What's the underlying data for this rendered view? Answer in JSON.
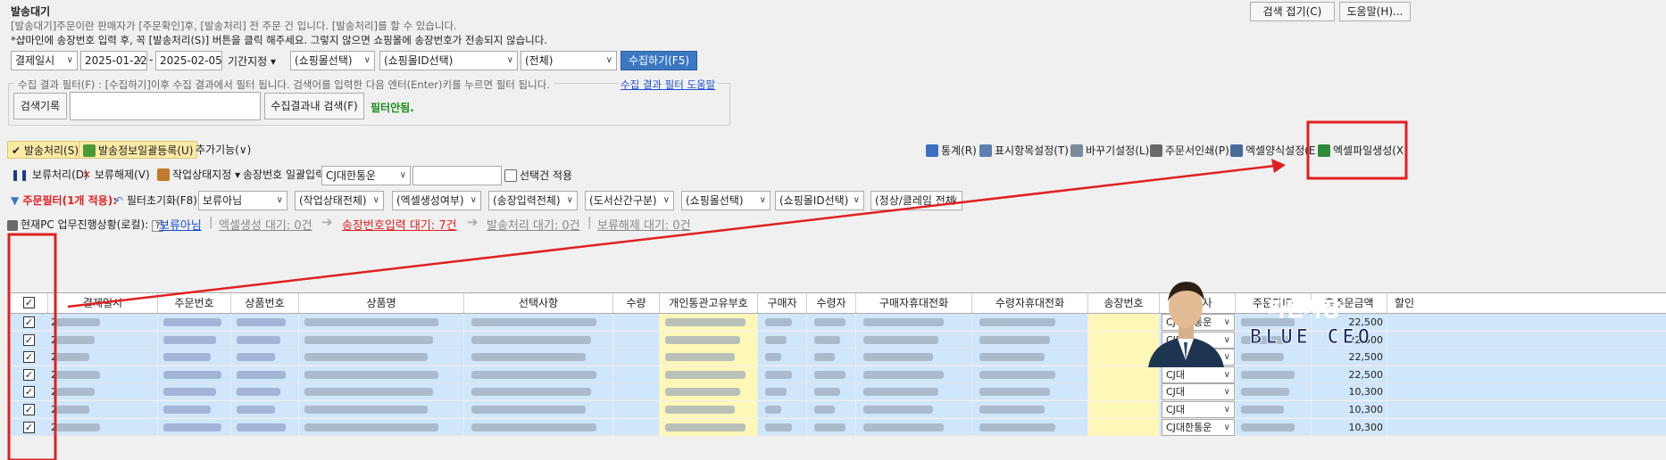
{
  "window": {
    "title": "발송대기"
  },
  "top_buttons": {
    "collapse_search": "검색 접기(C)",
    "help": "도움말(H)..."
  },
  "description": {
    "line1": "[발송대기]주문이란 판매자가 [주문확인]후, [발송처리] 전 주문 건 입니다. [발송처리]를 할 수 있습니다.",
    "line2": "*샵마인에 송장번호 입력 후, 꼭 [발송처리(S)] 버튼을 클릭 해주세요. 그렇지 않으면 쇼핑몰에 송장번호가 전송되지 않습니다."
  },
  "search": {
    "date_type": "결제일시",
    "date_from": "2025-01-22",
    "date_sep": "-",
    "date_to": "2025-02-05(",
    "period_label": "기간지정",
    "mall_select": "(쇼핑몰선택)",
    "mall_id_select": "(쇼핑몰ID선택)",
    "all_select": "(전체)",
    "collect_button": "수집하기(F5)"
  },
  "filter_box": {
    "legend": "수집 결과 필터(F) : [수집하기]이후 수집 결과에서 필터 됩니다. 검색어를 입력한 다음 엔터(Enter)키를 누르면 필터 됩니다.",
    "help_link": "수집 결과 필터 도움말",
    "history_button": "검색기록",
    "search_in_results_button": "수집결과내 검색(F)",
    "filter_status": "필터안됨."
  },
  "toolbar1": {
    "ship_process": "발송처리(S)",
    "bulk_register": "발송정보일괄등록(U)",
    "more_features": "추가기능(∨)",
    "stats": "통계(R)",
    "display_items": "표시항목설정(T)",
    "barcode_settings": "바꾸기설정(L)",
    "print_order": "주문서인쇄(P)",
    "excel_format": "엑셀양식설정(E",
    "excel_generate": "엑셀파일생성(X)"
  },
  "toolbar2": {
    "hold": "보류처리(D)",
    "unhold": "보류해제(V)",
    "work_status": "작업상태지정",
    "bulk_invoice_label": "송장번호 일괄입력",
    "courier_select": "CJ대한통운",
    "invoice_input": "",
    "apply_selected": "선택건 적용"
  },
  "toolbar3": {
    "order_filter": "주문필터(1개 적용):",
    "reset_filter": "필터초기화(F8)",
    "f_hold": "보류아님",
    "f_work": "(작업상태전체)",
    "f_excel": "(엑셀생성여부)",
    "f_invoice": "(송장입력전체)",
    "f_island": "(도서산간구분)",
    "f_mall": "(쇼핑몰선택)",
    "f_mall_id": "(쇼핑몰ID선택)",
    "f_status": "(정상/클레임 전체"
  },
  "progress": {
    "label": "현재PC 업무진행상황(로컬):",
    "help": "?",
    "hold_status": "보류아님",
    "excel_wait": "엑셀생성 대기: 0건",
    "invoice_wait": "송장번호입력 대기: 7건",
    "ship_wait": "발송처리 대기: 0건",
    "unhold_wait": "보류해제 대기: 0건"
  },
  "table": {
    "columns": [
      "결제일시",
      "주문번호",
      "상품번호",
      "상품명",
      "선택사항",
      "수량",
      "개인통관고유부호",
      "구매자",
      "수령자",
      "구매자휴대전화",
      "수령자휴대전화",
      "송장번호",
      "택배사",
      "주문자ID",
      "총주문금액",
      "할인"
    ],
    "rows": [
      {
        "date": "2",
        "courier": "CJ대한통운",
        "total": "22,500"
      },
      {
        "date": "2",
        "courier": "CJ대",
        "total": "22,500"
      },
      {
        "date": "2",
        "courier": "CJ대",
        "total": "22,500"
      },
      {
        "date": "2",
        "courier": "CJ대",
        "total": "22,500"
      },
      {
        "date": "2",
        "courier": "CJ대",
        "total": "10,300"
      },
      {
        "date": "2",
        "courier": "CJ대",
        "total": "10,300"
      },
      {
        "date": "2",
        "courier": "CJ대한통운",
        "total": "10,300"
      }
    ]
  },
  "watermark": {
    "korean": "파란사장",
    "english": "BLUE CEO"
  },
  "colors": {
    "accent": "#3a78c2",
    "annotation": "#e02020",
    "row_bg": "#cfe6fb",
    "invoice_cell": "#fff7b8"
  }
}
